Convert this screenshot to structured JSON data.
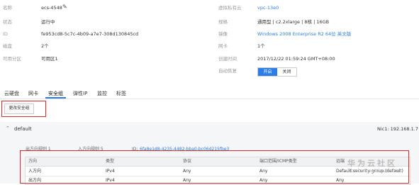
{
  "details": {
    "name_label": "名称",
    "name_value": "ecs-4548",
    "status_label": "状态",
    "status_value": "运行中",
    "id_label": "ID",
    "id_value": "fe953cd8-5c7c-4b09-a7e7-308d130845cd",
    "disk_label": "磁盘",
    "disk_value": "2个",
    "az_label": "可用分区",
    "az_value": "可用区1",
    "vpc_label": "虚拟私有云",
    "vpc_value": "vpc-13e0",
    "spec_label": "规格",
    "spec_value": "通用型 | c2.2xlarge | 8核 | 16GB",
    "image_label": "镜像",
    "image_value": "Windows 2008 Enterprise R2 64位 英文版",
    "nic_label": "网卡",
    "nic_value": "1个",
    "created_label": "创建时间",
    "created_value": "2017/12/22 01:59:24 GMT+08:00",
    "recover_label": "自动恢复",
    "recover_on": "开启",
    "recover_off": "关闭"
  },
  "tabs": [
    "云硬盘",
    "网卡",
    "安全组",
    "弹性IP",
    "监控",
    "标签"
  ],
  "active_tab": "安全组",
  "change_sg_button": "更改安全组",
  "security_group": {
    "name": "default",
    "nic": "Nic1: 192.168.1.7",
    "outbound_rules": "出方向规则  1",
    "inbound_rules": "入方向规则  5",
    "id_label": "ID:",
    "id_value": "6fa8e1d8-4235-4482-bba0-bc06d215fbe3"
  },
  "rules_table": {
    "headers": [
      "方向",
      "类型",
      "协议",
      "端口范围/ICMP类型",
      "远端"
    ],
    "rows": [
      [
        "入方向",
        "IPv4",
        "Any",
        "Any",
        "Default security group (default)"
      ],
      [
        "出方向",
        "IPv4",
        "Any",
        "Any",
        "Any"
      ]
    ]
  },
  "watermark": {
    "line1": "华为云社区",
    "line2": "bbs.huaweicloud.com"
  },
  "colors": {
    "accent": "#2b7de9",
    "highlight_border": "#e02a2a"
  }
}
